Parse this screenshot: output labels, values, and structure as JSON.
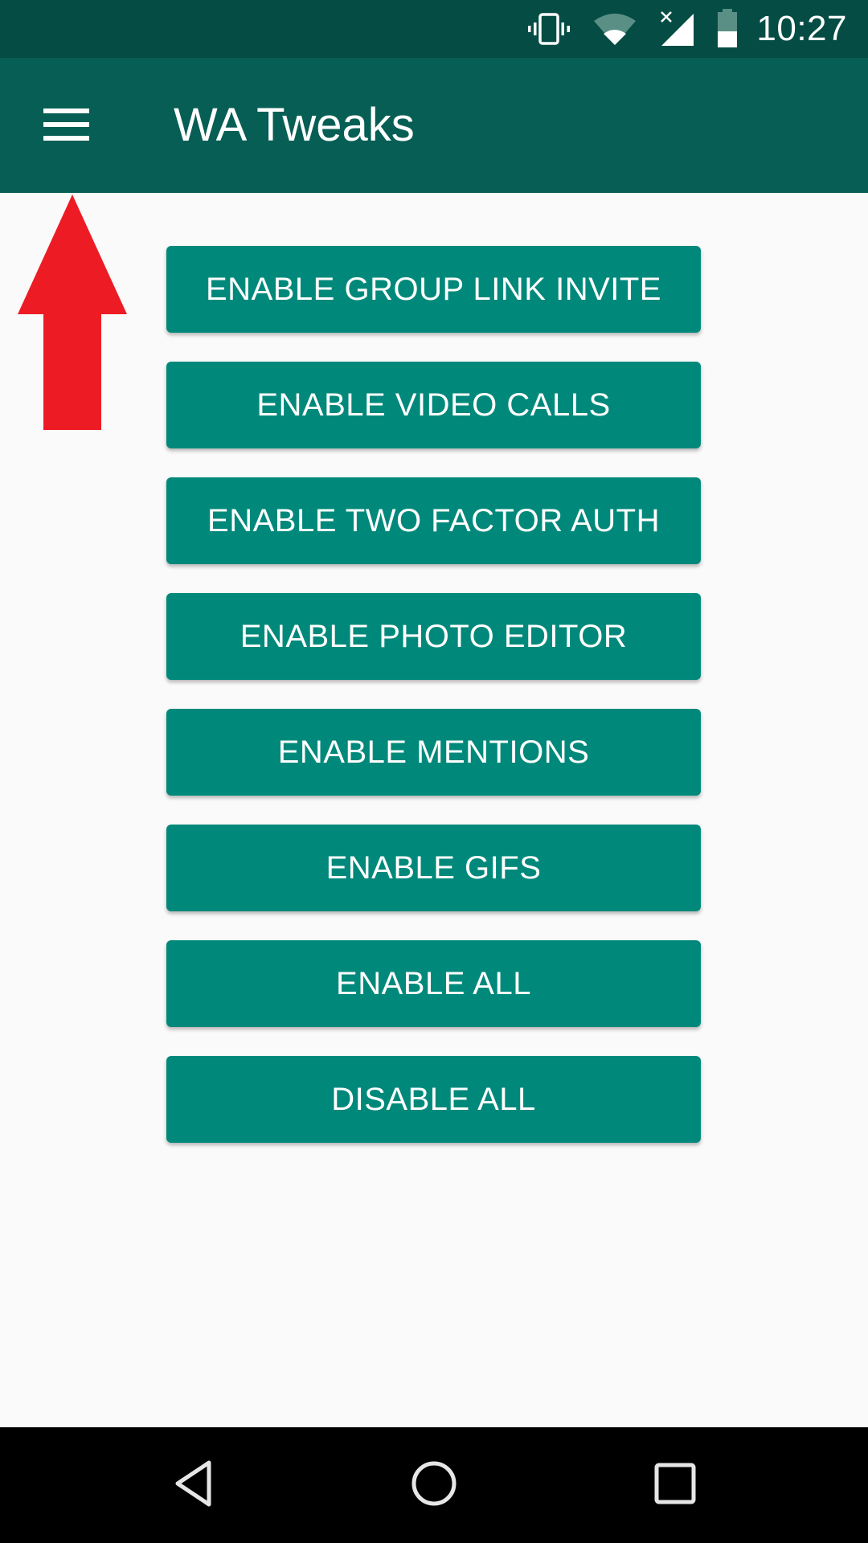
{
  "status_bar": {
    "time": "10:27",
    "icons": [
      "vibrate-icon",
      "wifi-icon",
      "signal-no-service-icon",
      "battery-icon"
    ],
    "background_color": "#054d44"
  },
  "app_bar": {
    "title": "WA Tweaks",
    "menu_icon": "hamburger-menu-icon",
    "background_color": "#075e54"
  },
  "annotation": {
    "icon": "red-up-arrow",
    "color": "#ed1c24"
  },
  "buttons": [
    {
      "label": "ENABLE GROUP LINK INVITE"
    },
    {
      "label": "ENABLE VIDEO CALLS"
    },
    {
      "label": "ENABLE TWO FACTOR AUTH"
    },
    {
      "label": "ENABLE PHOTO EDITOR"
    },
    {
      "label": "ENABLE MENTIONS"
    },
    {
      "label": "ENABLE GIFS"
    },
    {
      "label": "ENABLE ALL"
    },
    {
      "label": "DISABLE ALL"
    }
  ],
  "button_color": "#00897b",
  "nav_bar": {
    "items": [
      "back-icon",
      "home-icon",
      "recents-icon"
    ]
  }
}
